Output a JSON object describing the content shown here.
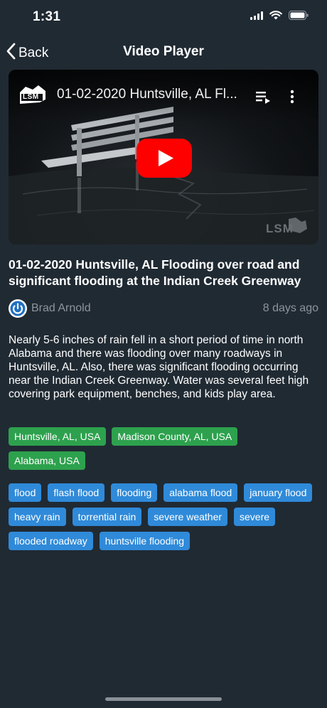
{
  "status_bar": {
    "time": "1:31"
  },
  "nav": {
    "back_label": "Back",
    "title": "Video Player"
  },
  "video": {
    "overlay_title": "01-02-2020 Huntsville, AL Fl...",
    "channel_logo_text": "LSM",
    "watermark_text": "LSM"
  },
  "heading": "01-02-2020 Huntsville, AL Flooding over road and significant flooding at the Indian Creek Greenway",
  "author": {
    "name": "Brad Arnold",
    "posted": "8 days ago"
  },
  "description": "Nearly 5-6 inches of rain fell in a short period of time in north Alabama and there was flooding over many roadways in Huntsville, AL. Also, there was significant flooding occurring near the Indian Creek Greenway. Water was several feet high covering park equipment, benches, and kids play area.",
  "location_tags": [
    "Huntsville, AL, USA",
    "Madison County, AL, USA",
    "Alabama, USA"
  ],
  "keyword_tags": [
    "flood",
    "flash flood",
    "flooding",
    "alabama flood",
    "january flood",
    "heavy rain",
    "torrential rain",
    "severe weather",
    "severe",
    "flooded roadway",
    "huntsville flooding"
  ],
  "colors": {
    "background": "#202a33",
    "location_tag": "#2da14d",
    "keyword_tag": "#2f8ad9",
    "youtube_red": "#ff0000",
    "muted_text": "#8d949b"
  }
}
